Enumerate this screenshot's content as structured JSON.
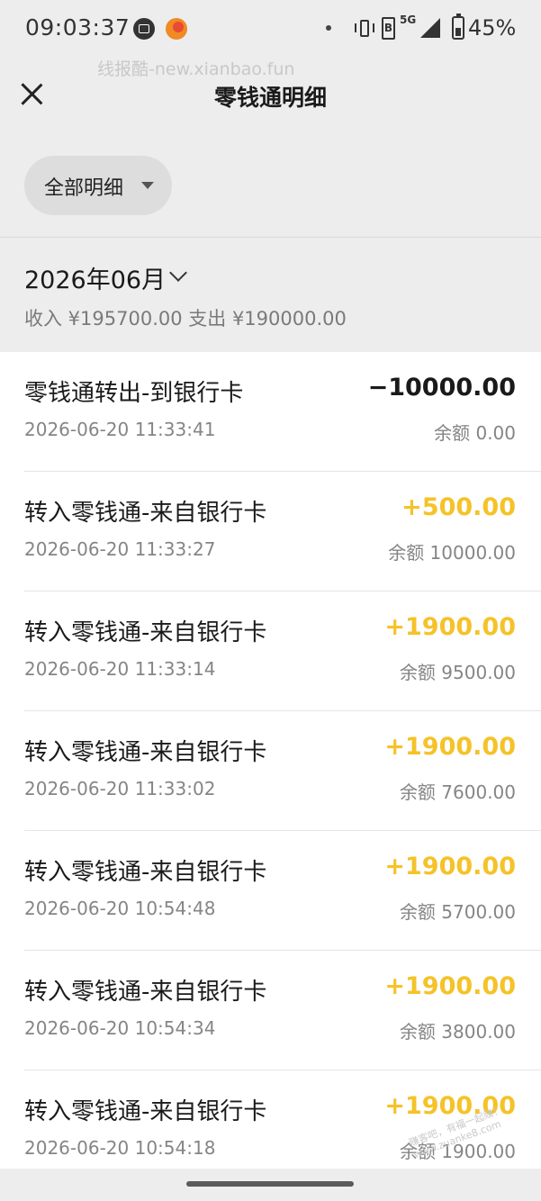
{
  "status_bar": {
    "time": "09:03:37",
    "network": "5G",
    "battery": "45%"
  },
  "watermark": "线报酷-new.xianbao.fun",
  "header": {
    "title": "零钱通明细"
  },
  "filter": {
    "label": "全部明细"
  },
  "month": {
    "title": "2026年06月",
    "summary": "收入 ¥195700.00 支出 ¥190000.00"
  },
  "transactions": [
    {
      "title": "零钱通转出-到银行卡",
      "time": "2026-06-20 11:33:41",
      "amount": "−10000.00",
      "balance": "余额 0.00",
      "type": "out"
    },
    {
      "title": "转入零钱通-来自银行卡",
      "time": "2026-06-20 11:33:27",
      "amount": "+500.00",
      "balance": "余额 10000.00",
      "type": "in"
    },
    {
      "title": "转入零钱通-来自银行卡",
      "time": "2026-06-20 11:33:14",
      "amount": "+1900.00",
      "balance": "余额 9500.00",
      "type": "in"
    },
    {
      "title": "转入零钱通-来自银行卡",
      "time": "2026-06-20 11:33:02",
      "amount": "+1900.00",
      "balance": "余额 7600.00",
      "type": "in"
    },
    {
      "title": "转入零钱通-来自银行卡",
      "time": "2026-06-20 10:54:48",
      "amount": "+1900.00",
      "balance": "余额 5700.00",
      "type": "in"
    },
    {
      "title": "转入零钱通-来自银行卡",
      "time": "2026-06-20 10:54:34",
      "amount": "+1900.00",
      "balance": "余额 3800.00",
      "type": "in"
    },
    {
      "title": "转入零钱通-来自银行卡",
      "time": "2026-06-20 10:54:18",
      "amount": "+1900.00",
      "balance": "余额 1900.00",
      "type": "in"
    }
  ],
  "colors": {
    "income": "#f5c228",
    "expense": "#1a1a1a",
    "background": "#ededed"
  },
  "stamp": "赚客吧，有福一起赚！www.zuanke8.com"
}
